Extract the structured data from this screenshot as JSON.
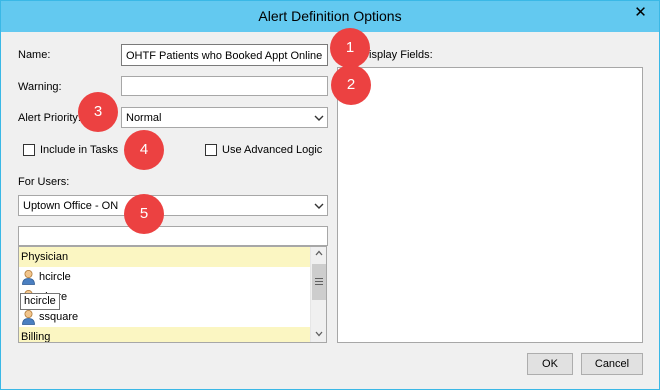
{
  "window": {
    "title": "Alert Definition Options",
    "close_glyph": "✕"
  },
  "form": {
    "name_label": "Name:",
    "name_value": "OHTF Patients who Booked Appt Online",
    "warning_label": "Warning:",
    "warning_value": "",
    "priority_label": "Alert Priority:",
    "priority_value": "Normal",
    "include_tasks_label": "Include in Tasks",
    "include_tasks_checked": false,
    "advanced_logic_label": "Use Advanced Logic",
    "advanced_logic_checked": false,
    "for_users_label": "For Users:",
    "for_users_value": "Uptown Office - ON",
    "user_search_value": ""
  },
  "user_list": {
    "items": [
      {
        "type": "group",
        "label": "Physician"
      },
      {
        "type": "user",
        "label": "hcircle",
        "icon": "user-icon"
      },
      {
        "type": "user",
        "label": "nhere",
        "icon": "user-icon"
      },
      {
        "type": "user",
        "label": "ssquare",
        "icon": "user-icon"
      },
      {
        "type": "group",
        "label": "Billing"
      }
    ],
    "tooltip": "hcircle"
  },
  "display_fields": {
    "label_visible": "t Display Fields:"
  },
  "buttons": {
    "ok": "OK",
    "cancel": "Cancel"
  },
  "markers": [
    "1",
    "2",
    "3",
    "4",
    "5"
  ],
  "colors": {
    "titlebar": "#63c9f0",
    "marker": "#ec4141",
    "group_row": "#fbf6c2"
  }
}
